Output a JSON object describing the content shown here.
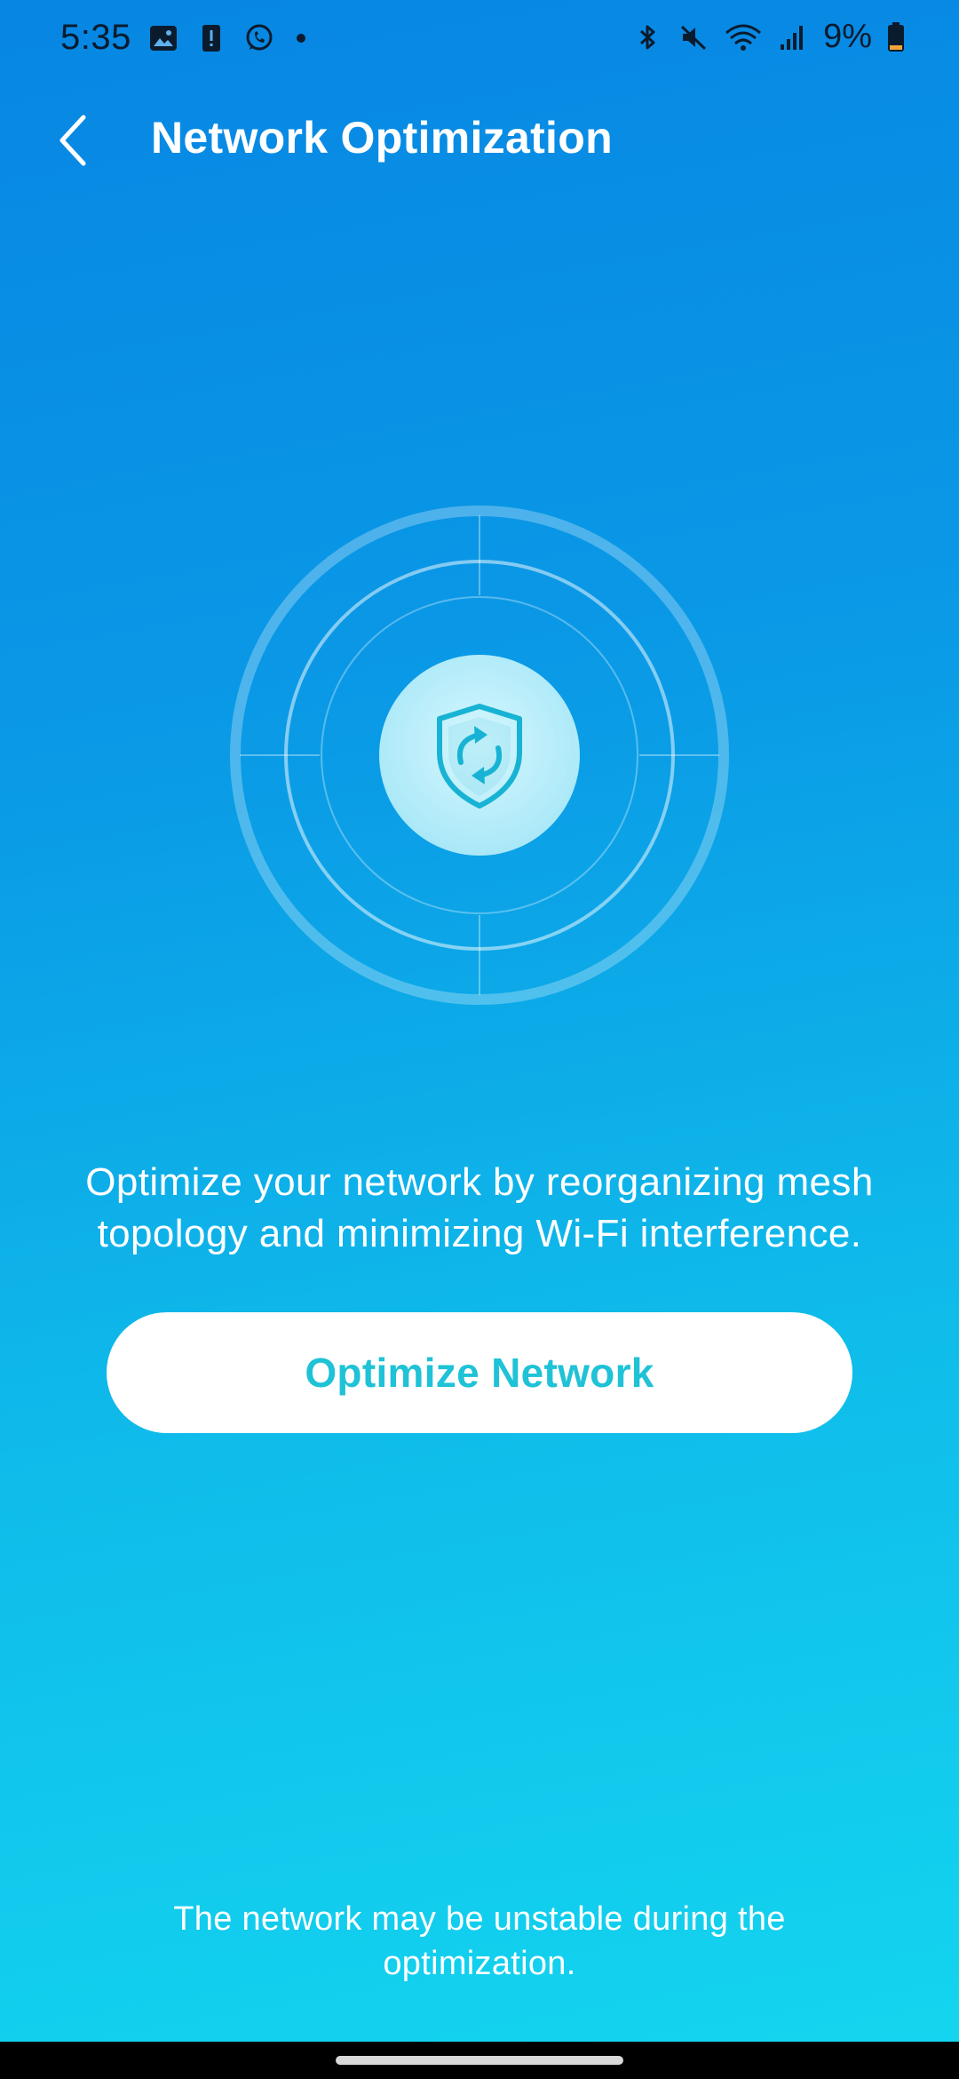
{
  "status_bar": {
    "time": "5:35",
    "battery_text": "9%",
    "left_icons": [
      "image-icon",
      "alert-icon",
      "whatsapp-icon",
      "notification-dot"
    ],
    "right_icons": [
      "bluetooth-icon",
      "mute-icon",
      "wifi-icon",
      "signal-icon",
      "battery-icon"
    ]
  },
  "header": {
    "title": "Network Optimization",
    "back_icon": "chevron-left-icon"
  },
  "illustration": {
    "icon": "shield-refresh-icon"
  },
  "content": {
    "description": "Optimize your network by reorganizing mesh topology and minimizing Wi-Fi interference.",
    "button_label": "Optimize Network",
    "warning": "The network may be unstable during the optimization."
  },
  "colors": {
    "gradient_top": "#0786e3",
    "gradient_bottom": "#14d6ef",
    "button_text": "#1fc2d6",
    "button_bg": "#ffffff",
    "center_disc": "#c9f3fb",
    "shield_accent": "#18b3d4"
  }
}
